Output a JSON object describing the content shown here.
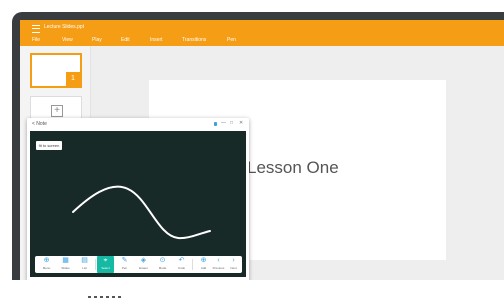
{
  "app": {
    "file_title": "Lecture Slides.ppt"
  },
  "menu": [
    "File",
    "View",
    "Play",
    "Edit",
    "Insert",
    "Transitions",
    "Pen"
  ],
  "slides_panel": {
    "active_slide_number": "1",
    "add_slide_icon": "plus-icon"
  },
  "slide": {
    "title": "Lesson One"
  },
  "annotation_window": {
    "back_label": "< Note",
    "controls": [
      "—",
      "□",
      "✕"
    ],
    "fit_button_label": "fit to screen",
    "tools": [
      {
        "name": "menu",
        "label": "Menu",
        "icon": "⊕"
      },
      {
        "name": "slides",
        "label": "Slides",
        "icon": "▦"
      },
      {
        "name": "list",
        "label": "List",
        "icon": "▤"
      },
      {
        "name": "select",
        "label": "Select",
        "icon": "⌖",
        "active": true
      },
      {
        "name": "pen",
        "label": "Pen",
        "icon": "✎"
      },
      {
        "name": "eraser",
        "label": "Eraser",
        "icon": "◈"
      },
      {
        "name": "mode",
        "label": "Mode",
        "icon": "⊙"
      },
      {
        "name": "undo",
        "label": "Undo",
        "icon": "↶"
      },
      {
        "name": "add",
        "label": "Add",
        "icon": "⊕"
      },
      {
        "name": "previous",
        "label": "Previous",
        "icon": "‹"
      },
      {
        "name": "next",
        "label": "Next",
        "icon": "›"
      }
    ]
  },
  "colors": {
    "accent": "#f59d14",
    "annotation_canvas": "#172a28",
    "tool_active": "#16b9a3"
  }
}
